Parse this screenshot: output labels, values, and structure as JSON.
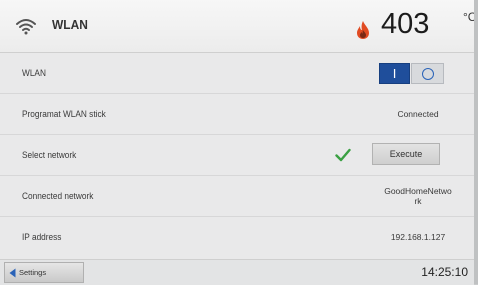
{
  "header": {
    "title": "WLAN",
    "temperature": "403",
    "unit": "°C",
    "icons": [
      "wifi-icon",
      "flame-icon"
    ]
  },
  "rows": [
    {
      "label": "WLAN",
      "toggle": {
        "on_label": "I",
        "state": "on"
      }
    },
    {
      "label": "Programat WLAN stick",
      "value": "Connected"
    },
    {
      "label": "Select network",
      "status_icon": "check-icon",
      "button": "Execute"
    },
    {
      "label": "Connected network",
      "value": "GoodHomeNetwo\nrk"
    },
    {
      "label": "IP address",
      "value": "192.168.1.127"
    }
  ],
  "footer": {
    "back_label": "Settings",
    "time": "14:25:10"
  },
  "colors": {
    "accent_blue": "#1f4e9b",
    "check_green": "#3aa043",
    "flame": "#e14b22"
  }
}
